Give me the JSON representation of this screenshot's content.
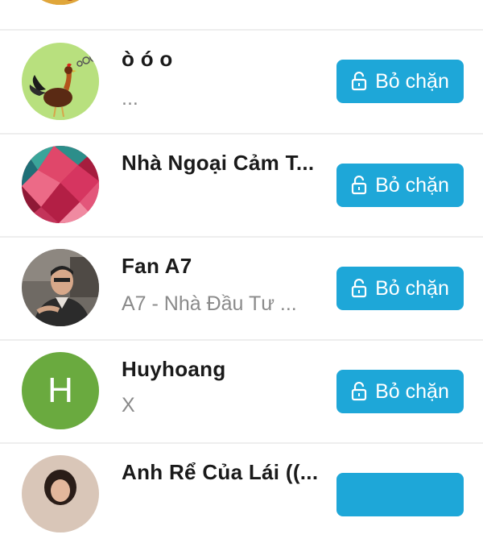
{
  "button_color": "#1ea7d8",
  "rows": [
    {
      "name": "",
      "subtitle": "",
      "button": ""
    },
    {
      "name": "ò ó o",
      "subtitle": "...",
      "button": "Bỏ chặn",
      "avatar": "rooster-avatar"
    },
    {
      "name": "Nhà Ngoại Cảm T...",
      "subtitle": "",
      "button": "Bỏ chặn",
      "avatar": "polygon-avatar"
    },
    {
      "name": "Fan A7",
      "subtitle": "A7 - Nhà Đầu Tư ...",
      "button": "Bỏ chặn",
      "avatar": "man-avatar"
    },
    {
      "name": "Huyhoang",
      "subtitle": "X",
      "button": "Bỏ chặn",
      "avatar": "letter-avatar",
      "initial": "H",
      "initial_color": "#6aaa3f"
    },
    {
      "name": "Anh Rể Của Lái ((...",
      "subtitle": "",
      "button": "",
      "avatar": "person-avatar"
    }
  ]
}
